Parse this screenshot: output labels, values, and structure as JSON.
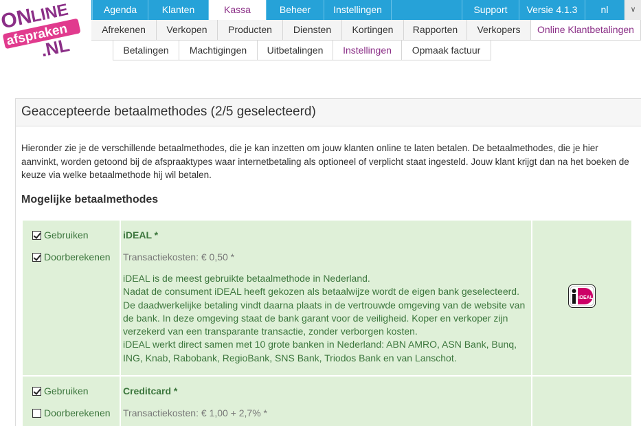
{
  "logo": {
    "line1": "ON",
    "line2": "LINE",
    "line3": "afspraken",
    "line4": ".NL"
  },
  "topnav": {
    "items": [
      "Agenda",
      "Klanten",
      "Kassa",
      "Beheer",
      "Instellingen"
    ],
    "support": "Support",
    "version": "Versie 4.1.3",
    "language": "nl",
    "active": "Kassa"
  },
  "subnav": {
    "items": [
      "Afrekenen",
      "Verkopen",
      "Producten",
      "Diensten",
      "Kortingen",
      "Rapporten",
      "Verkopers",
      "Online Klantbetalingen"
    ],
    "active": "Online Klantbetalingen"
  },
  "thirdnav": {
    "items": [
      "Betalingen",
      "Machtigingen",
      "Uitbetalingen",
      "Instellingen",
      "Opmaak factuur"
    ],
    "active": "Instellingen"
  },
  "panel": {
    "title": "Geaccepteerde betaalmethodes (2/5 geselecteerd)",
    "intro": "Hieronder zie je de verschillende betaalmethodes, die je kan inzetten om jouw klanten online te laten betalen. De betaalmethodes, die je hier aanvinkt, worden getoond bij de afspraaktypes waar internetbetaling als optioneel of verplicht staat ingesteld. Jouw klant krijgt dan na het boeken de keuze via welke betaalmethode hij wil betalen.",
    "section_title": "Mogelijke betaalmethodes"
  },
  "methods": [
    {
      "use_label": "Gebruiken",
      "use_checked": true,
      "charge_label": "Doorberekenen",
      "charge_checked": true,
      "name": "iDEAL *",
      "cost": "Transactiekosten: € 0,50 *",
      "description": [
        "iDEAL is de meest gebruikte betaalmethode in Nederland.",
        "Nadat de consument iDEAL heeft gekozen als betaalwijze wordt de eigen bank geselecteerd.",
        "De daadwerkelijke betaling vindt daarna plaats in de vertrouwde omgeving van de website van de bank. In deze omgeving staat de bank garant voor de veiligheid. Koper en verkoper zijn verzekerd van een transparante transactie, zonder verborgen kosten.",
        "iDEAL werkt direct samen met 10 grote banken in Nederland: ABN AMRO, ASN Bank, Bunq, ING, Knab, Rabobank, RegioBank, SNS Bank, Triodos Bank en van Lanschot."
      ],
      "logo_text": "iDEAL"
    },
    {
      "use_label": "Gebruiken",
      "use_checked": true,
      "charge_label": "Doorberekenen",
      "charge_checked": false,
      "name": "Creditcard *",
      "cost": "Transactiekosten: € 1,00 + 2,7% *"
    }
  ],
  "colors": {
    "topnav_bg": "#26a2d8",
    "active_purple": "#8b2f87",
    "row_green": "#dff0d8",
    "text_green": "#3c763d"
  }
}
